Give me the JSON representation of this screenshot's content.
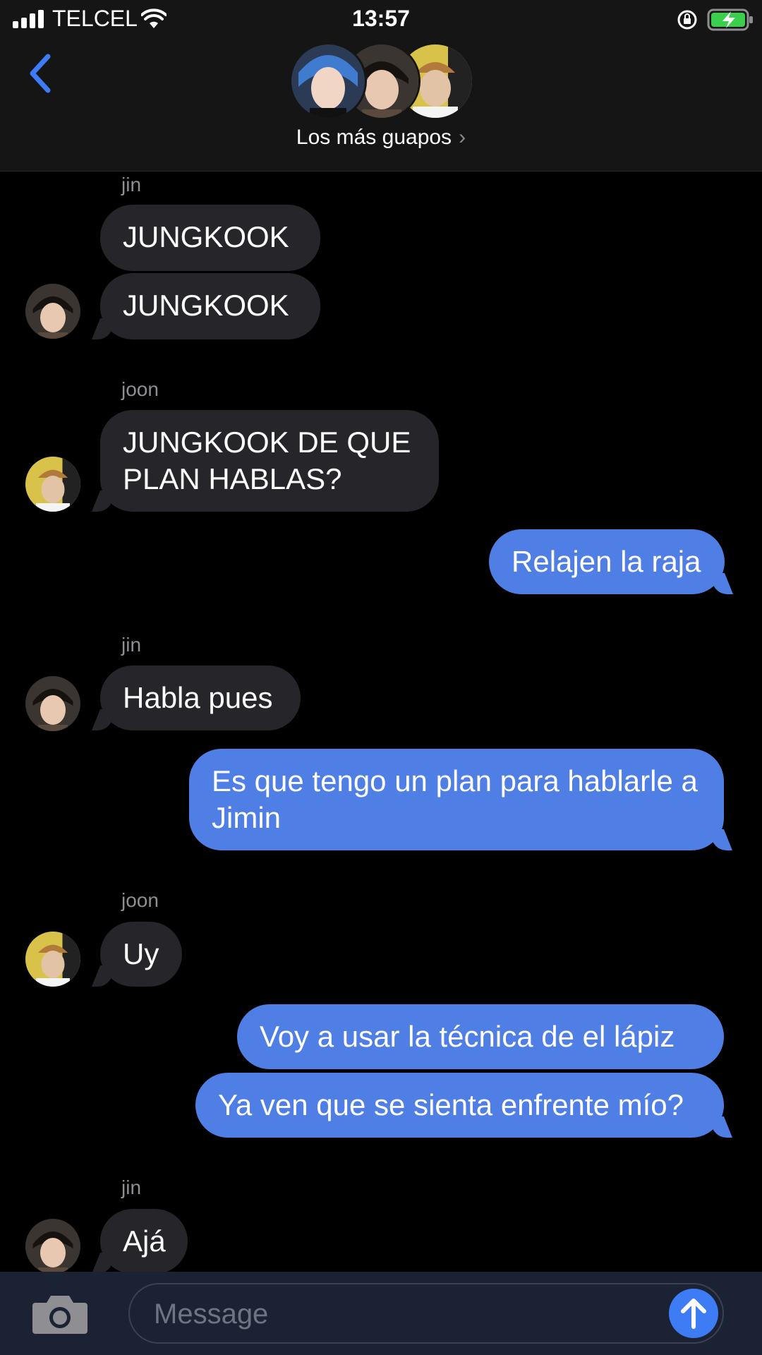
{
  "status_bar": {
    "carrier": "TELCEL",
    "time": "13:57",
    "icons": [
      "signal-icon",
      "wifi-icon",
      "rotation-lock-icon",
      "battery-charging-icon"
    ]
  },
  "header": {
    "group_name": "Los más guapos",
    "chevron": "›",
    "back_icon": "back-chevron-icon"
  },
  "messages": [
    {
      "sender": "jin"
    },
    {
      "text": "JUNGKOOK"
    },
    {
      "text": "JUNGKOOK"
    },
    {
      "sender": "joon"
    },
    {
      "text": "JUNGKOOK DE QUE PLAN HABLAS?"
    },
    {
      "text": "Relajen la raja"
    },
    {
      "sender": "jin"
    },
    {
      "text": "Habla pues"
    },
    {
      "text": "Es que tengo un plan para hablarle a Jimin"
    },
    {
      "sender": "joon"
    },
    {
      "text": "Uy"
    },
    {
      "text": "Voy a usar la técnica de el lápiz"
    },
    {
      "text": "Ya ven que se sienta enfrente mío?"
    },
    {
      "sender": "jin"
    },
    {
      "text": "Ajá"
    }
  ],
  "composer": {
    "placeholder": "Message",
    "camera_icon": "camera-icon",
    "send_icon": "send-arrow-icon"
  },
  "colors": {
    "outgoing_bubble": "#4f7fe4",
    "incoming_bubble": "#26252a",
    "accent": "#3d7cf5"
  }
}
